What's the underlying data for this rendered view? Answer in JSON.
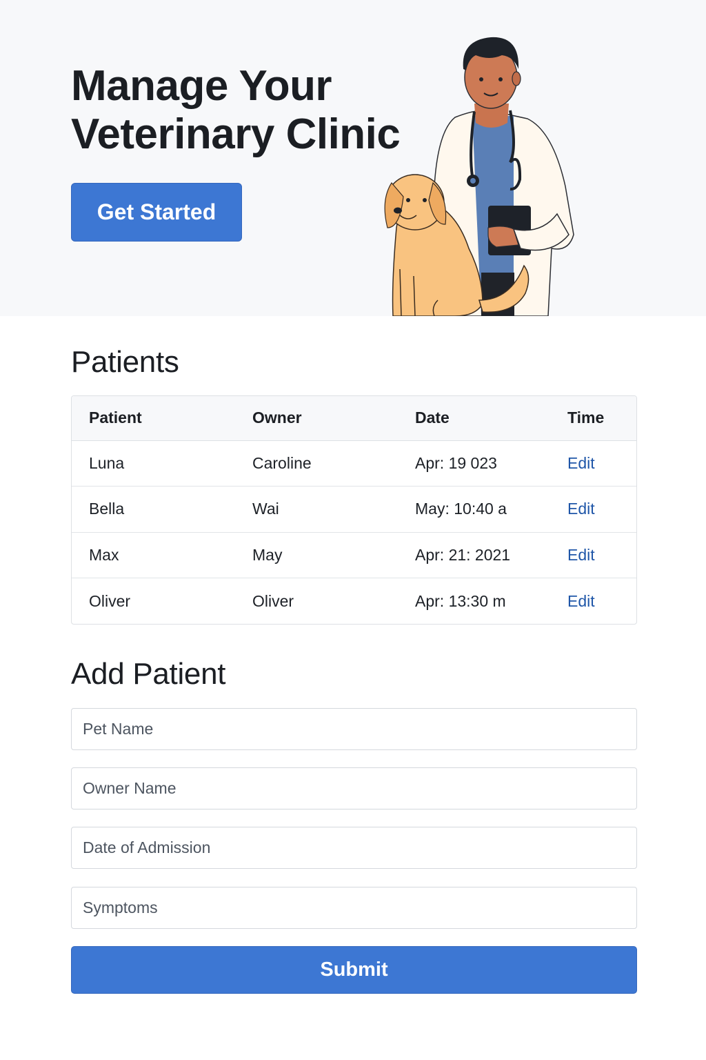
{
  "hero": {
    "title_line1": "Manage Your",
    "title_line2": "Veterinary Clinic",
    "cta_label": "Get Started"
  },
  "patients": {
    "title": "Patients",
    "columns": [
      "Patient",
      "Owner",
      "Date",
      "Time"
    ],
    "rows": [
      {
        "patient": "Luna",
        "owner": "Caroline",
        "date": "Apr: 19 023",
        "action": "Edit"
      },
      {
        "patient": "Bella",
        "owner": "Wai",
        "date": "May: 10:40 a",
        "action": "Edit"
      },
      {
        "patient": "Max",
        "owner": "May",
        "date": "Apr: 21: 2021",
        "action": "Edit"
      },
      {
        "patient": "Oliver",
        "owner": "Oliver",
        "date": "Apr: 13:30 m",
        "action": "Edit"
      }
    ]
  },
  "form": {
    "title": "Add Patient",
    "pet_name_placeholder": "Pet Name",
    "owner_name_placeholder": "Owner Name",
    "date_placeholder": "Date of Admission",
    "symptoms_placeholder": "Symptoms",
    "submit_label": "Submit"
  },
  "colors": {
    "primary": "#3d77d3",
    "link": "#1f56a8",
    "hero_bg": "#f7f8fa"
  }
}
